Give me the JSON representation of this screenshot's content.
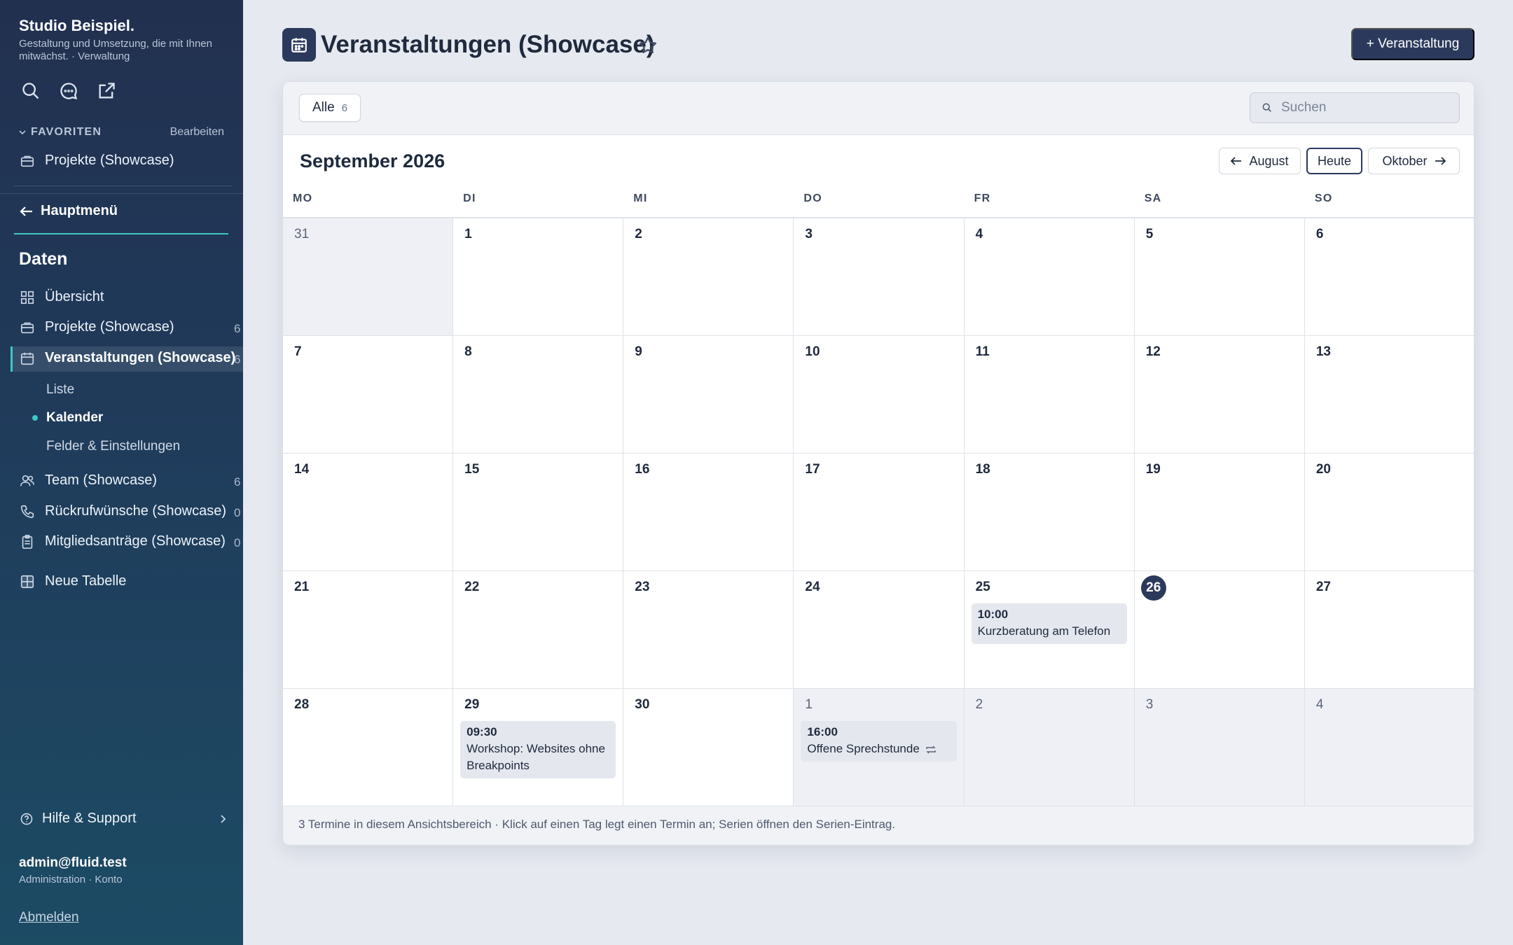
{
  "sidebar": {
    "brand": "Studio Beispiel.",
    "subtitle": "Gestaltung und Umsetzung, die mit Ihnen mitwächst. · Verwaltung",
    "favorites_label": "FAVORITEN",
    "favorites_edit": "Bearbeiten",
    "favorites": [
      {
        "label": "Projekte (Showcase)"
      }
    ],
    "back_label": "Hauptmenü",
    "section_title": "Daten",
    "items": [
      {
        "label": "Übersicht",
        "count": ""
      },
      {
        "label": "Projekte (Showcase)",
        "count": "6"
      },
      {
        "label": "Veranstaltungen (Showcase)",
        "count": "6"
      },
      {
        "label": "Team (Showcase)",
        "count": "6"
      },
      {
        "label": "Rückrufwünsche (Showcase)",
        "count": "0"
      },
      {
        "label": "Mitgliedsanträge (Showcase)",
        "count": "0"
      },
      {
        "label": "Neue Tabelle",
        "count": ""
      }
    ],
    "subitems": [
      {
        "label": "Liste"
      },
      {
        "label": "Kalender"
      },
      {
        "label": "Felder & Einstellungen"
      }
    ],
    "help": "Hilfe & Support",
    "user_email": "admin@fluid.test",
    "user_sub": "Administration · Konto",
    "logout": "Abmelden"
  },
  "header": {
    "title": "Veranstaltungen (Showcase)",
    "new_button": "+ Veranstaltung"
  },
  "toolbar": {
    "filter_label": "Alle",
    "filter_count": "6",
    "search_placeholder": "Suchen"
  },
  "calendar": {
    "month_title": "September 2026",
    "prev_label": "August",
    "today_label": "Heute",
    "next_label": "Oktober",
    "weekdays": [
      "MO",
      "DI",
      "MI",
      "DO",
      "FR",
      "SA",
      "SO"
    ],
    "weeks": [
      [
        {
          "d": "31",
          "out": true
        },
        {
          "d": "1"
        },
        {
          "d": "2"
        },
        {
          "d": "3"
        },
        {
          "d": "4"
        },
        {
          "d": "5"
        },
        {
          "d": "6"
        }
      ],
      [
        {
          "d": "7"
        },
        {
          "d": "8"
        },
        {
          "d": "9"
        },
        {
          "d": "10"
        },
        {
          "d": "11"
        },
        {
          "d": "12"
        },
        {
          "d": "13"
        }
      ],
      [
        {
          "d": "14"
        },
        {
          "d": "15"
        },
        {
          "d": "16"
        },
        {
          "d": "17"
        },
        {
          "d": "18"
        },
        {
          "d": "19"
        },
        {
          "d": "20"
        }
      ],
      [
        {
          "d": "21"
        },
        {
          "d": "22"
        },
        {
          "d": "23"
        },
        {
          "d": "24"
        },
        {
          "d": "25",
          "events": [
            {
              "time": "10:00",
              "title": "Kurzberatung am Telefon"
            }
          ]
        },
        {
          "d": "26",
          "today": true
        },
        {
          "d": "27"
        }
      ],
      [
        {
          "d": "28"
        },
        {
          "d": "29",
          "events": [
            {
              "time": "09:30",
              "title": "Workshop: Websites ohne Breakpoints"
            }
          ]
        },
        {
          "d": "30"
        },
        {
          "d": "1",
          "out": true,
          "events": [
            {
              "time": "16:00",
              "title": "Offene Sprechstunde",
              "series": true
            }
          ]
        },
        {
          "d": "2",
          "out": true
        },
        {
          "d": "3",
          "out": true
        },
        {
          "d": "4",
          "out": true
        }
      ]
    ],
    "footer": "3 Termine in diesem Ansichtsbereich · Klick auf einen Tag legt einen Termin an; Serien öffnen den Serien-Eintrag."
  }
}
